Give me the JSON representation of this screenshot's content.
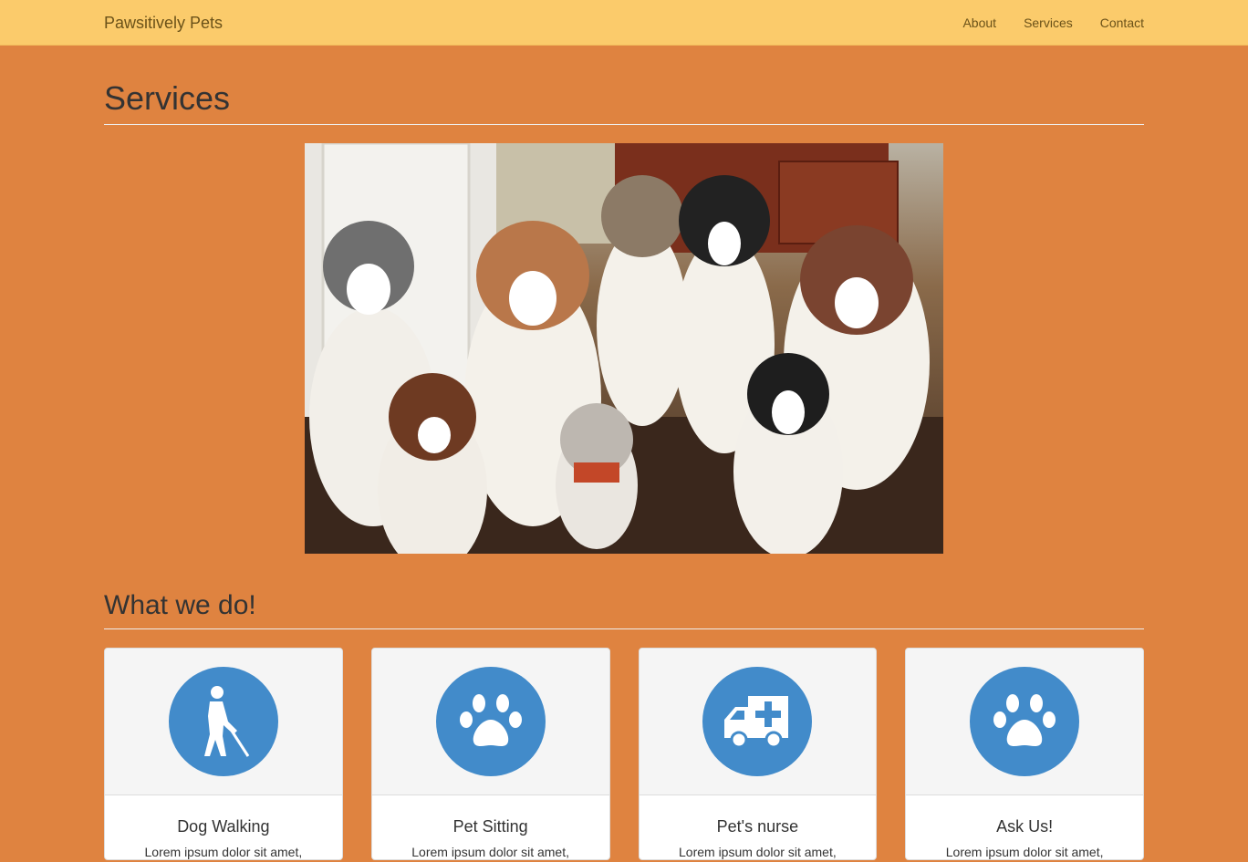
{
  "navbar": {
    "brand": "Pawsitively Pets",
    "links": [
      "About",
      "Services",
      "Contact"
    ]
  },
  "page": {
    "title": "Services",
    "section_title": "What we do!"
  },
  "cards": [
    {
      "icon": "blind-walker-icon",
      "title": "Dog Walking",
      "text": "Lorem ipsum dolor sit amet,"
    },
    {
      "icon": "paw-icon",
      "title": "Pet Sitting",
      "text": "Lorem ipsum dolor sit amet,"
    },
    {
      "icon": "ambulance-icon",
      "title": "Pet's nurse",
      "text": "Lorem ipsum dolor sit amet,"
    },
    {
      "icon": "paw-icon",
      "title": "Ask Us!",
      "text": "Lorem ipsum dolor sit amet,"
    }
  ],
  "colors": {
    "navbar": "#fbcb6b",
    "background": "#df8340",
    "icon_circle": "#428bca"
  }
}
